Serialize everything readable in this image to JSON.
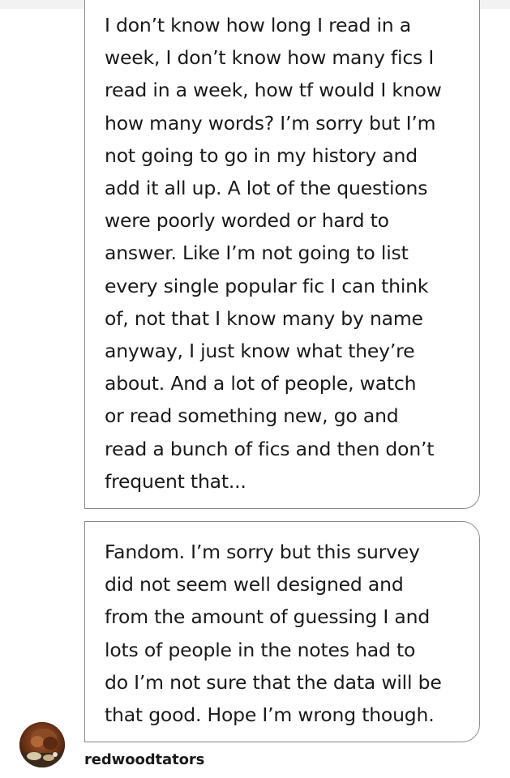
{
  "messages": [
    {
      "lines": [
        "I don’t know how long I read in a",
        "week, I don’t know how many fics I",
        "read in a week, how tf would I know",
        "how many words? I’m sorry but I’m",
        "not going to go in my history and",
        "add it all up.  A lot of the questions",
        "were poorly worded or hard to",
        "answer. Like I’m not going to list",
        "every single popular fic I can think",
        "of, not that I know many by name",
        "anyway, I just know what they’re",
        "about. And a lot of people, watch",
        "or read something new, go and",
        "read a bunch of fics and then don’t",
        "frequent that..."
      ]
    },
    {
      "lines": [
        "Fandom. I’m sorry but this survey",
        "did not seem well designed and",
        "from the amount of guessing I and",
        "lots of people in the notes had to",
        "do I’m not sure that the data will be",
        "that good. Hope I’m wrong though."
      ]
    }
  ],
  "author": {
    "username": "redwoodtators",
    "avatar_icon": "avatar-photo"
  },
  "colors": {
    "background": "#ffffff",
    "text": "#1a1a1a",
    "bubble_border": "#8a8a8a",
    "top_strip": "#f2f2f2"
  }
}
